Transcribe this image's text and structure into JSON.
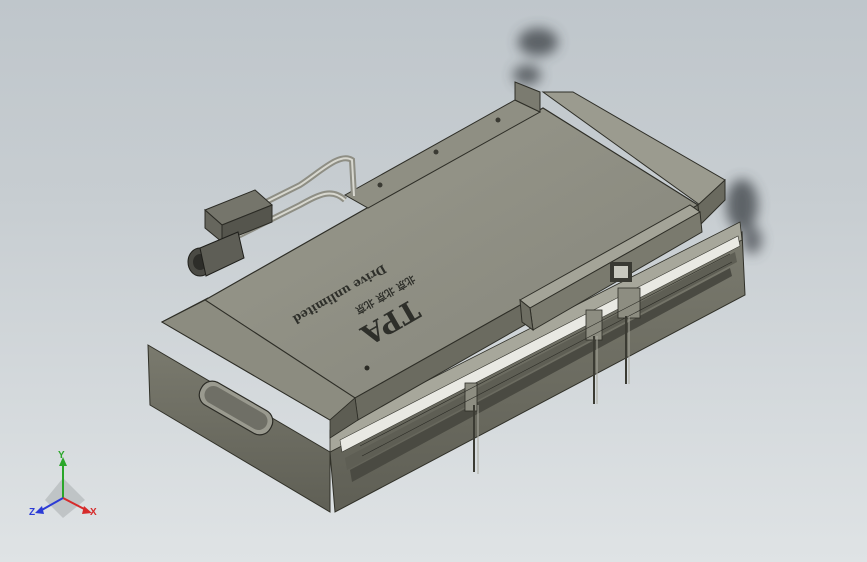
{
  "model": {
    "brand_text": "Drive unlimited",
    "logo_text": "TPA",
    "chinese_marks": "北京 北京 北京"
  },
  "triad": {
    "x_label": "X",
    "y_label": "Y",
    "z_label": "Z",
    "x_color": "#d62b2b",
    "y_color": "#2aa62a",
    "z_color": "#2b3bd6"
  },
  "colors": {
    "body_top": "#8d8d80",
    "body_side": "#6f6f63",
    "carriage_top": "#919184",
    "background": "#c7cdd1"
  }
}
